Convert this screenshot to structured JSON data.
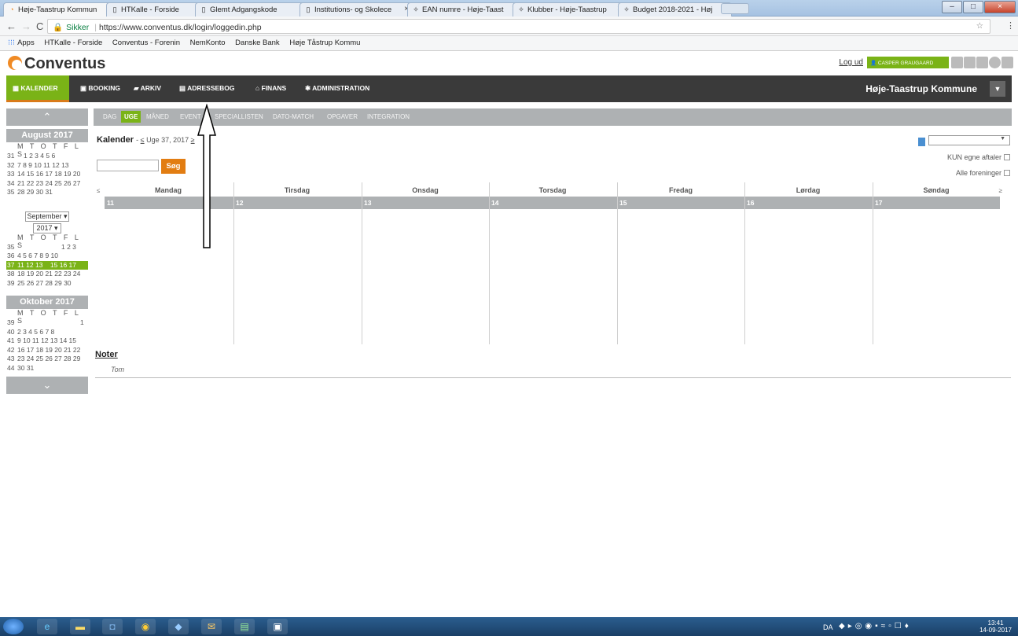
{
  "browser": {
    "tabs": [
      {
        "label": "Høje-Taastrup Kommun",
        "icon": "conventus-icon"
      },
      {
        "label": "HTKalle - Forside",
        "icon": "page-icon"
      },
      {
        "label": "Glemt Adgangskode",
        "icon": "page-icon"
      },
      {
        "label": "Institutions- og Skolece",
        "icon": "page-icon"
      },
      {
        "label": "EAN numre - Høje-Taast",
        "icon": "puzzle-icon"
      },
      {
        "label": "Klubber - Høje-Taastrup",
        "icon": "puzzle-icon"
      },
      {
        "label": "Budget 2018-2021 - Høj",
        "icon": "puzzle-icon"
      }
    ],
    "address": {
      "secure_label": "Sikker",
      "url": "https://www.conventus.dk/login/loggedin.php"
    },
    "bookmarks": [
      "Apps",
      "HTKalle - Forside",
      "Conventus - Forenin",
      "NemKonto",
      "Danske Bank",
      "Høje Tåstrup Kommu"
    ]
  },
  "app": {
    "logo": "Conventus",
    "logout": "Log ud",
    "user": "CASPER GRAUGAARD",
    "main_nav": [
      "KALENDER",
      "BOOKING",
      "ARKIV",
      "ADRESSEBOG",
      "FINANS",
      "ADMINISTRATION"
    ],
    "kommune": "Høje-Taastrup Kommune",
    "sub_nav": [
      "DAG",
      "UGE",
      "MÅNED",
      "EVENT",
      "SPECIALLISTEN",
      "DATO-MATCH",
      "OPGAVER",
      "INTEGRATION"
    ]
  },
  "sidebar": {
    "dow": "M T O T F L S",
    "months": [
      {
        "title": "August 2017",
        "weeks": [
          {
            "wk": "31",
            "days": "1  2  3  4  5  6"
          },
          {
            "wk": "32",
            "days": "7  8  9 10 11 12 13"
          },
          {
            "wk": "33",
            "days": "14 15 16 17 18 19 20"
          },
          {
            "wk": "34",
            "days": "21 22 23 24 25 26 27"
          },
          {
            "wk": "35",
            "days": "28 29 30 31"
          }
        ]
      },
      {
        "title_select": "September",
        "year_select": "2017",
        "weeks": [
          {
            "wk": "35",
            "days": "1  2  3"
          },
          {
            "wk": "36",
            "days": "4  5  6  7  8  9 10"
          },
          {
            "wk": "37",
            "days": "11 12 13    15 16 17"
          },
          {
            "wk": "38",
            "days": "18 19 20 21 22 23 24"
          },
          {
            "wk": "39",
            "days": "25 26 27 28 29 30"
          }
        ]
      },
      {
        "title": "Oktober 2017",
        "weeks": [
          {
            "wk": "39",
            "days": "1"
          },
          {
            "wk": "40",
            "days": "2  3  4  5  6  7  8"
          },
          {
            "wk": "41",
            "days": "9 10 11 12 13 14 15"
          },
          {
            "wk": "42",
            "days": "16 17 18 19 20 21 22"
          },
          {
            "wk": "43",
            "days": "23 24 25 26 27 28 29"
          },
          {
            "wk": "44",
            "days": "30 31"
          }
        ]
      }
    ]
  },
  "calendar": {
    "title": "Kalender",
    "week_label": "Uge 37, 2017",
    "prev": "≤",
    "next": "≥",
    "search_button": "Søg",
    "only_own": "KUN egne aftaler",
    "all_clubs": "Alle foreninger",
    "days": [
      {
        "name": "Mandag",
        "num": "11"
      },
      {
        "name": "Tirsdag",
        "num": "12"
      },
      {
        "name": "Onsdag",
        "num": "13"
      },
      {
        "name": "Torsdag",
        "num": "14"
      },
      {
        "name": "Fredag",
        "num": "15"
      },
      {
        "name": "Lørdag",
        "num": "16"
      },
      {
        "name": "Søndag",
        "num": "17"
      }
    ],
    "notes_title": "Noter",
    "notes_empty": "Tom"
  },
  "taskbar": {
    "lang": "DA",
    "time": "13:41",
    "date": "14-09-2017"
  }
}
